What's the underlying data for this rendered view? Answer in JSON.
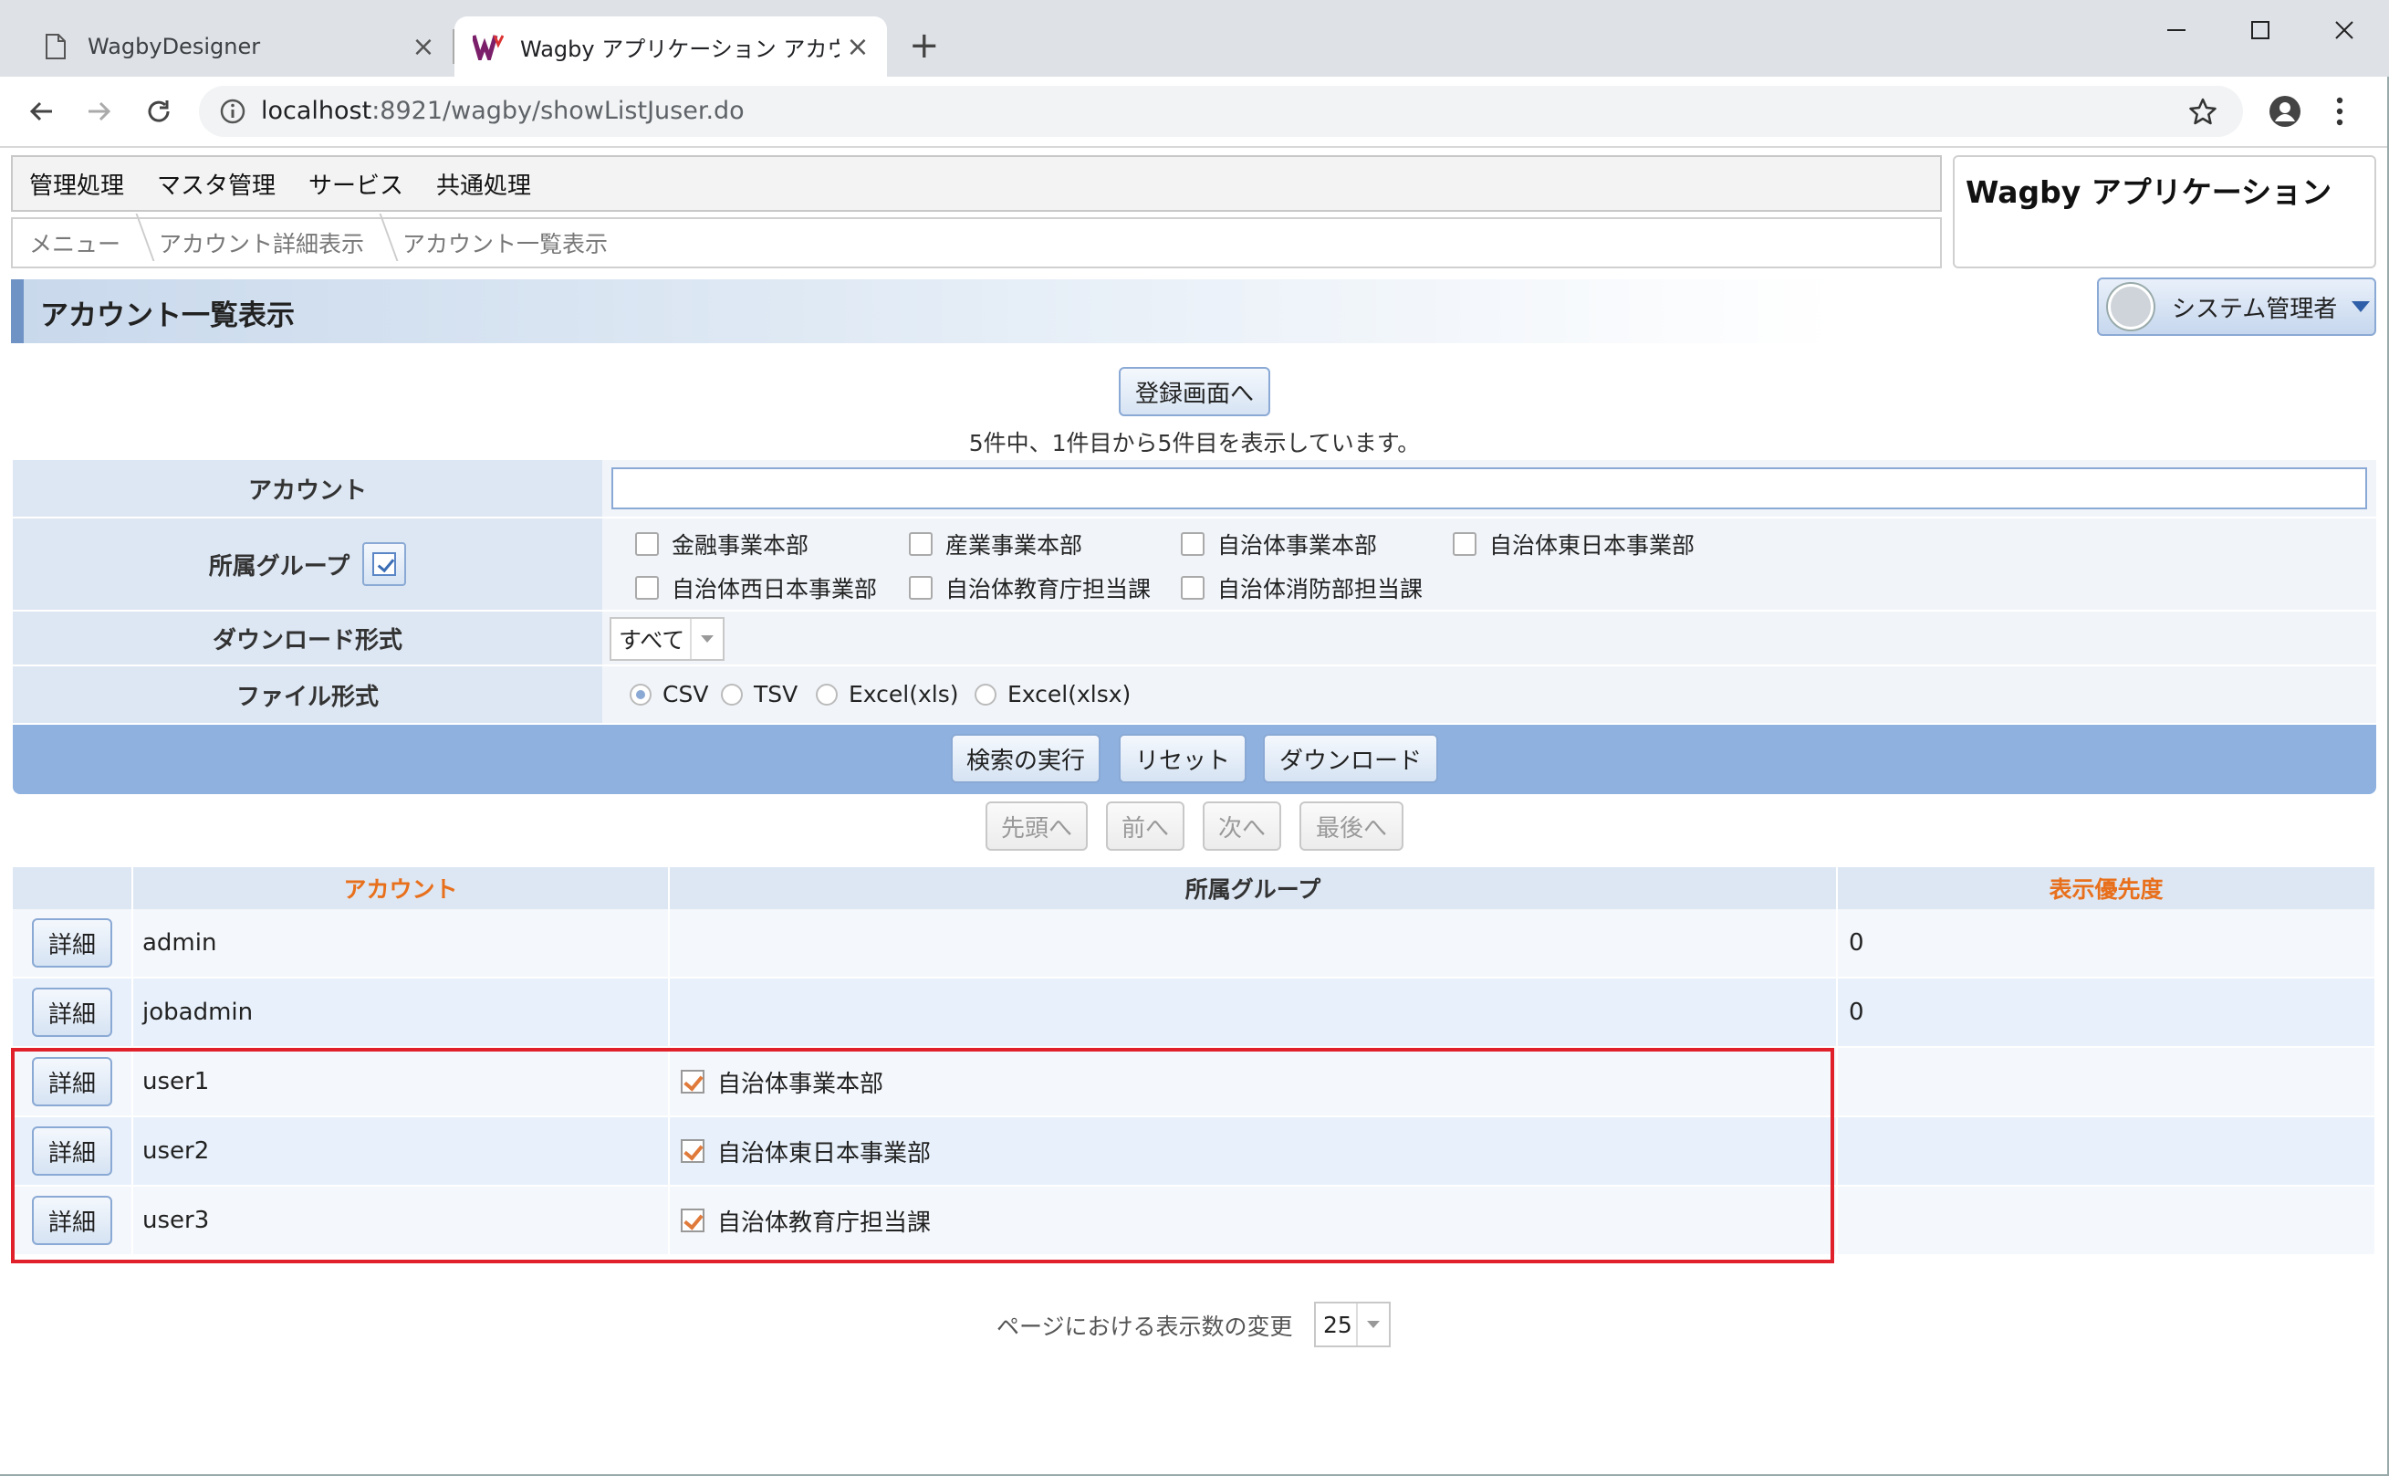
{
  "browser": {
    "tabs": [
      {
        "title": "WagbyDesigner"
      },
      {
        "title": "Wagby アプリケーション アカウント一覧"
      }
    ],
    "url_host": "localhost",
    "url_rest": ":8921/wagby/showListJuser.do"
  },
  "menu": [
    "管理処理",
    "マスタ管理",
    "サービス",
    "共通処理"
  ],
  "breadcrumb": [
    "メニュー",
    "アカウント詳細表示",
    "アカウント一覧表示"
  ],
  "app_title": "Wagby アプリケーション",
  "page_title": "アカウント一覧表示",
  "user_menu": "システム管理者",
  "register_button": "登録画面へ",
  "result_info": "5件中、1件目から5件目を表示しています。",
  "search": {
    "account_label": "アカウント",
    "account_value": "",
    "group_label": "所属グループ",
    "groups": [
      "金融事業本部",
      "産業事業本部",
      "自治体事業本部",
      "自治体東日本事業部",
      "自治体西日本事業部",
      "自治体教育庁担当課",
      "自治体消防部担当課"
    ],
    "download_label": "ダウンロード形式",
    "download_value": "すべて",
    "file_label": "ファイル形式",
    "file_formats": [
      "CSV",
      "TSV",
      "Excel(xls)",
      "Excel(xlsx)"
    ],
    "file_selected": "CSV"
  },
  "actions": {
    "search": "検索の実行",
    "reset": "リセット",
    "download": "ダウンロード"
  },
  "pager": {
    "first": "先頭へ",
    "prev": "前へ",
    "next": "次へ",
    "last": "最後へ"
  },
  "table": {
    "headers": {
      "account": "アカウント",
      "group": "所属グループ",
      "priority": "表示優先度"
    },
    "detail_label": "詳細",
    "rows": [
      {
        "account": "admin",
        "group": "",
        "priority": "0"
      },
      {
        "account": "jobadmin",
        "group": "",
        "priority": "0"
      },
      {
        "account": "user1",
        "group": "自治体事業本部",
        "priority": ""
      },
      {
        "account": "user2",
        "group": "自治体東日本事業部",
        "priority": ""
      },
      {
        "account": "user3",
        "group": "自治体教育庁担当課",
        "priority": ""
      }
    ]
  },
  "page_size": {
    "label": "ページにおける表示数の変更",
    "value": "25"
  },
  "colors": {
    "accent": "#8eb1e0",
    "sort_header": "#e8701c",
    "highlight": "#e0202a"
  }
}
